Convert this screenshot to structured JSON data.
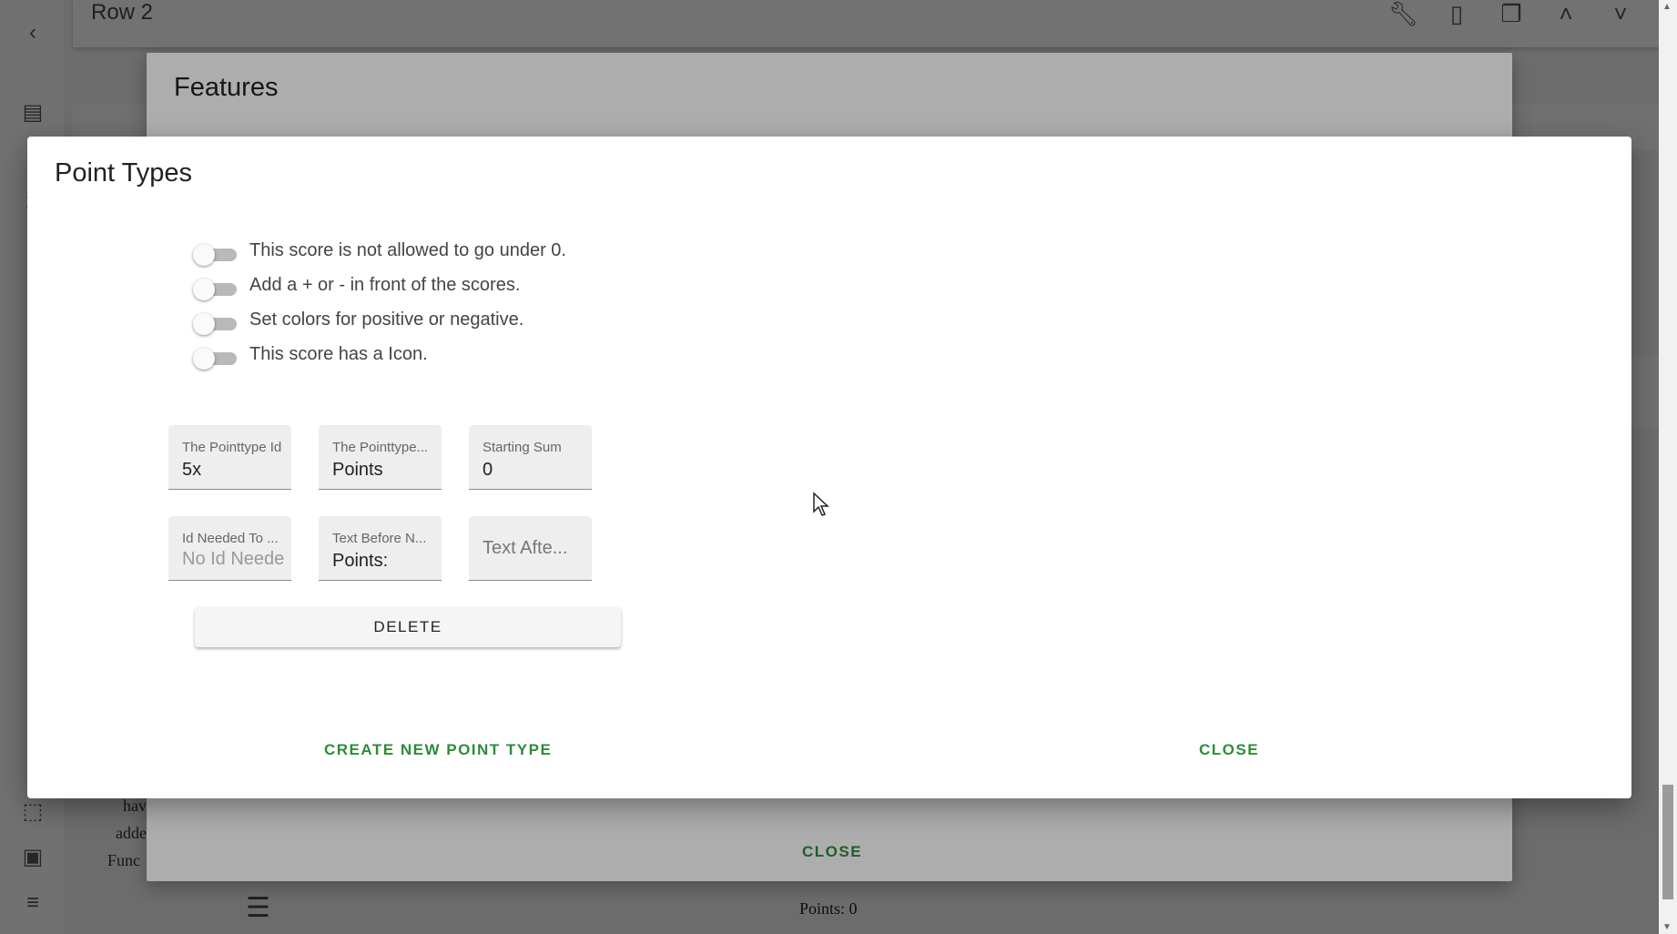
{
  "topbar": {
    "title": "Row 2"
  },
  "features_dialog": {
    "title": "Features",
    "close_label": "CLOSE"
  },
  "background": {
    "lines": [
      "hav",
      "adde",
      "Func"
    ],
    "bottom_points": "Points: 0"
  },
  "point_types_dialog": {
    "title": "Point Types",
    "toggles": [
      {
        "label": "This score is not allowed to go under 0.",
        "on": false
      },
      {
        "label": "Add a + or - in front of the scores.",
        "on": false
      },
      {
        "label": "Set colors for positive or negative.",
        "on": false
      },
      {
        "label": "This score has a Icon.",
        "on": false
      }
    ],
    "fields": {
      "pointtype_id": {
        "label": "The Pointtype Id",
        "value": "5x"
      },
      "pointtype_name": {
        "label": "The Pointtype...",
        "value": "Points"
      },
      "starting_sum": {
        "label": "Starting Sum",
        "value": "0"
      },
      "id_needed": {
        "label": "Id Needed To ...",
        "placeholder": "No Id Needed"
      },
      "text_before": {
        "label": "Text Before N...",
        "value": "Points:"
      },
      "text_after": {
        "placeholder": "Text Afte..."
      }
    },
    "delete_label": "DELETE",
    "create_label": "CREATE NEW POINT TYPE",
    "close_label": "CLOSE"
  },
  "colors": {
    "accent": "#2e8b3a",
    "switch_track": "#b9b9b9"
  }
}
